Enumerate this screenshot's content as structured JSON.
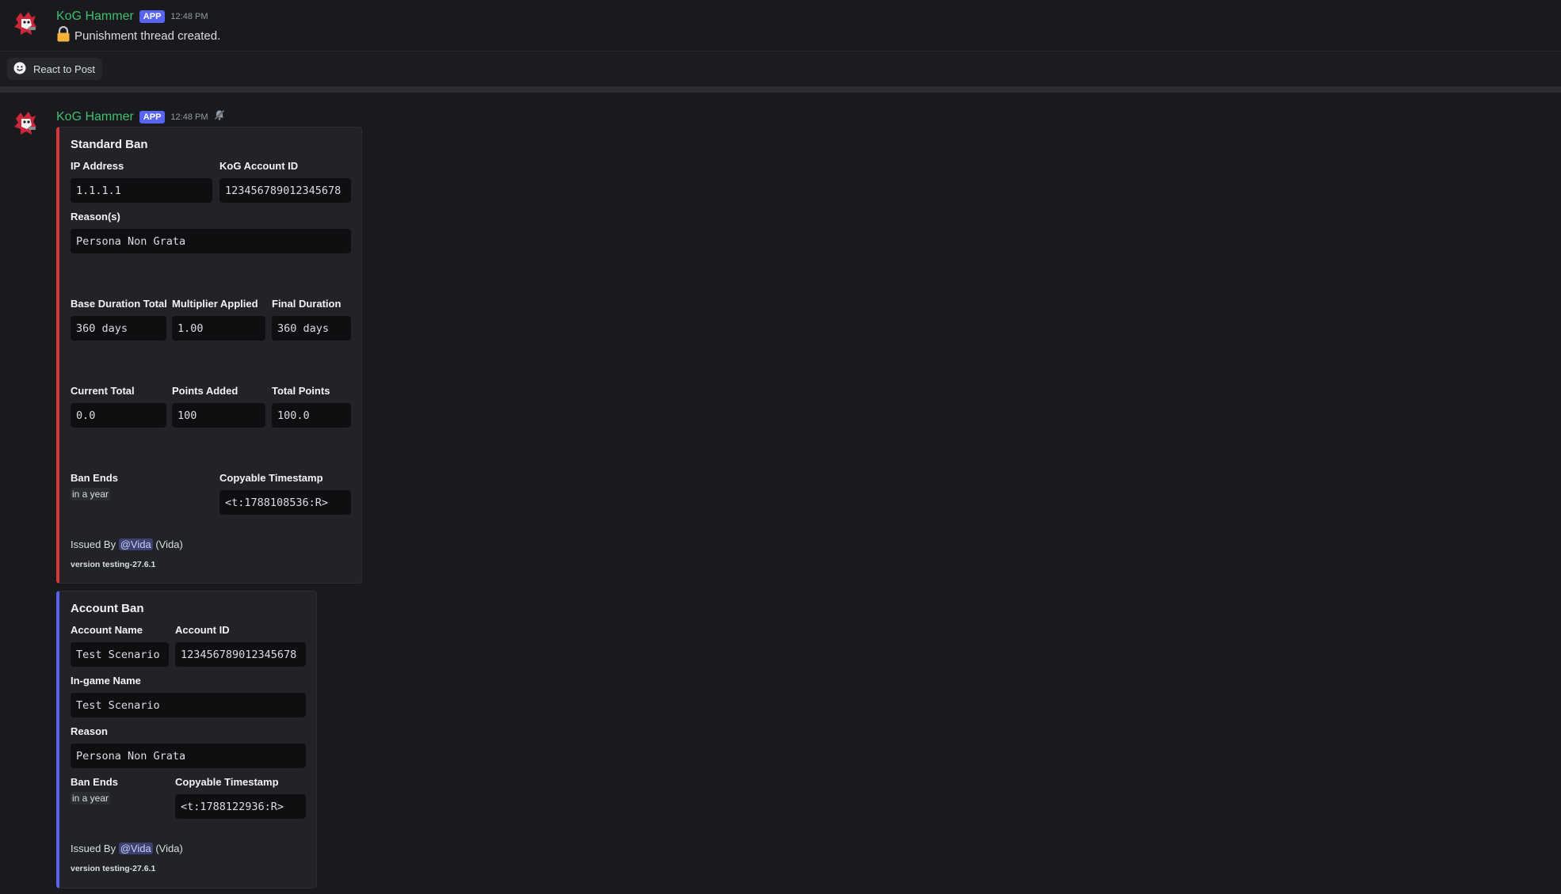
{
  "messages": [
    {
      "author": "KoG Hammer",
      "badge": "APP",
      "time": "12:48 PM",
      "text": "Punishment thread created.",
      "icon": "lock-icon"
    },
    {
      "author": "KoG Hammer",
      "badge": "APP",
      "time": "12:48 PM",
      "icon": "bell-off-icon"
    }
  ],
  "react_button": {
    "label": "React to Post",
    "icon": "smile-icon"
  },
  "standard_ban": {
    "accent": "#da373c",
    "title": "Standard Ban",
    "ip_label": "IP Address",
    "ip_value": "1.1.1.1",
    "account_id_label": "KoG Account ID",
    "account_id_value": "123456789012345678",
    "reasons_label": "Reason(s)",
    "reasons_value": "Persona Non Grata",
    "base_duration_label": "Base Duration Total",
    "base_duration_value": "360 days",
    "multiplier_label": "Multiplier Applied",
    "multiplier_value": "1.00",
    "final_duration_label": "Final Duration",
    "final_duration_value": "360 days",
    "current_total_label": "Current Total",
    "current_total_value": "0.0",
    "points_added_label": "Points Added",
    "points_added_value": "100",
    "total_points_label": "Total Points",
    "total_points_value": "100.0",
    "ban_ends_label": "Ban Ends",
    "ban_ends_value": "in a year",
    "timestamp_label": "Copyable Timestamp",
    "timestamp_value": "<t:1788108536:R>",
    "issued_prefix": "Issued By",
    "issued_mention": "@Vida",
    "issued_suffix": "(Vida)",
    "footer": "version testing-27.6.1"
  },
  "account_ban": {
    "accent": "#5865f2",
    "title": "Account Ban",
    "account_name_label": "Account Name",
    "account_name_value": "Test Scenario",
    "account_id_label": "Account ID",
    "account_id_value": "123456789012345678",
    "ingame_label": "In-game Name",
    "ingame_value": "Test Scenario",
    "reason_label": "Reason",
    "reason_value": "Persona Non Grata",
    "ban_ends_label": "Ban Ends",
    "ban_ends_value": "in a year",
    "timestamp_label": "Copyable Timestamp",
    "timestamp_value": "<t:1788122936:R>",
    "issued_prefix": "Issued By",
    "issued_mention": "@Vida",
    "issued_suffix": "(Vida)",
    "footer": "version testing-27.6.1"
  }
}
